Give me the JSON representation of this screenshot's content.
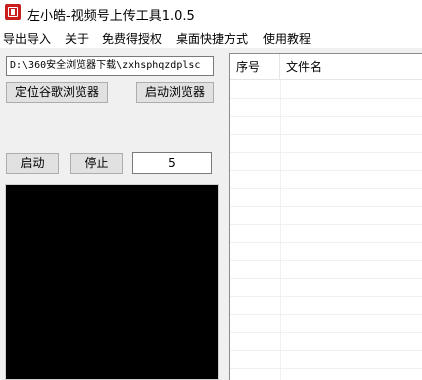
{
  "window": {
    "title": "左小皓-视频号上传工具1.0.5",
    "icon": "app-seal-icon"
  },
  "menu": {
    "items": [
      "导出导入",
      "关于",
      "免费得授权",
      "桌面快捷方式",
      "使用教程"
    ]
  },
  "controls": {
    "path_value": "D:\\360安全浏览器下载\\zxhsphqzdplsc",
    "locate_chrome_label": "定位谷歌浏览器",
    "launch_browser_label": "启动浏览器",
    "start_label": "启动",
    "stop_label": "停止",
    "count_value": "5"
  },
  "file_list": {
    "columns": [
      "序号",
      "文件名"
    ],
    "rows": []
  },
  "colors": {
    "log_background": "#000000",
    "window_background": "#f0f0f0",
    "button_face": "#e1e1e1"
  }
}
